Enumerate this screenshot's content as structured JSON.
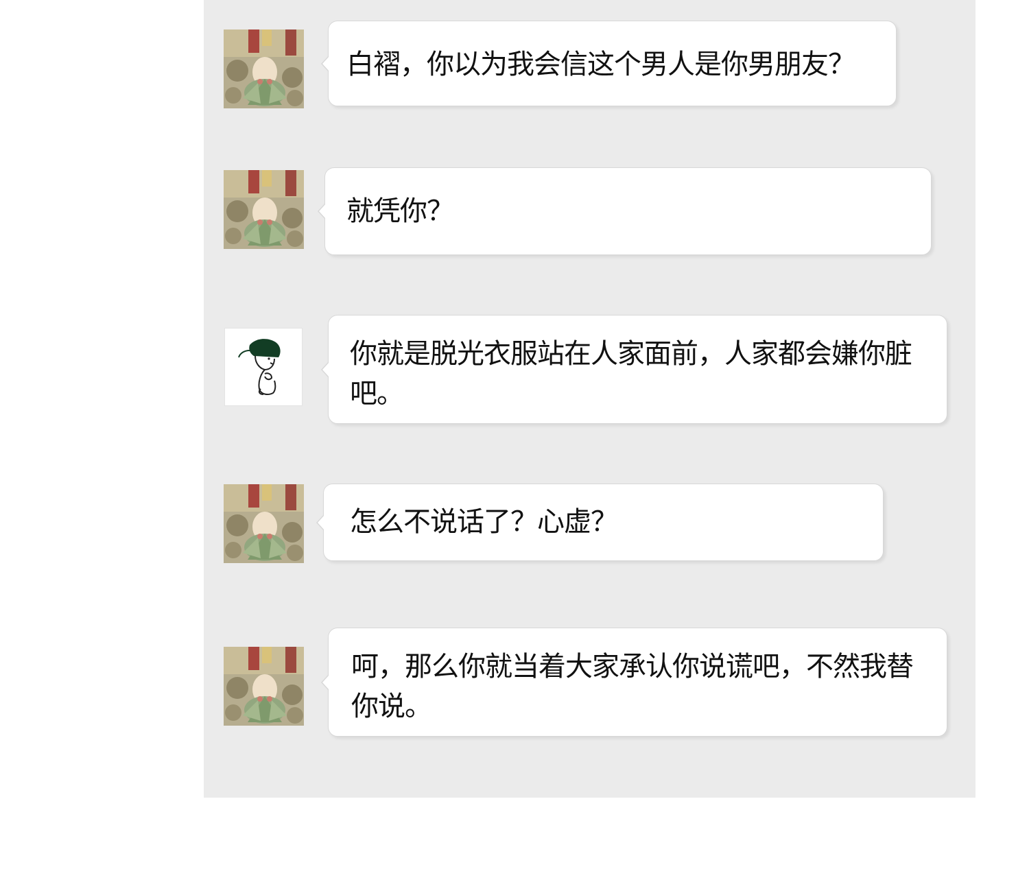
{
  "messages": [
    {
      "sender": "flower-avatar",
      "text": "白褶，你以为我会信这个男人是你男朋友？"
    },
    {
      "sender": "flower-avatar",
      "text": "就凭你？"
    },
    {
      "sender": "sketch-avatar",
      "text": "你就是脱光衣服站在人家面前，人家都会嫌你脏吧。"
    },
    {
      "sender": "flower-avatar",
      "text": "怎么不说话了？心虚？"
    },
    {
      "sender": "flower-avatar",
      "text": "呵，那么你就当着大家承认你说谎吧，不然我替你说。"
    }
  ],
  "colors": {
    "chat_background": "#ebebeb",
    "bubble": "#ffffff",
    "bubble_border": "#d8d8d8"
  }
}
